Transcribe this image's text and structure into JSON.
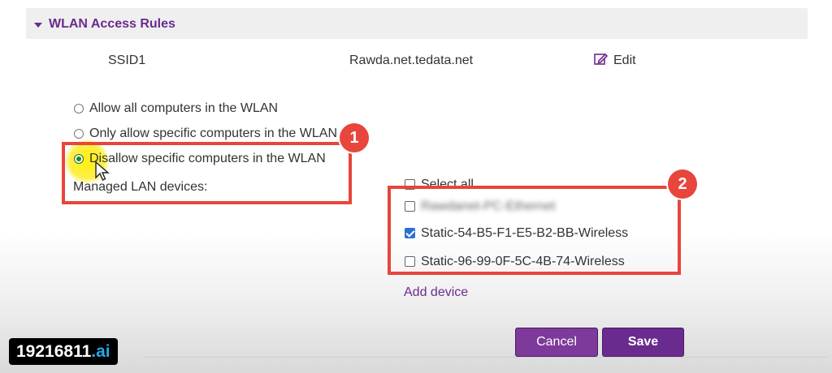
{
  "section": {
    "title": "WLAN Access Rules",
    "ssid_label": "SSID1",
    "ssid_value": "Rawda.net.tedata.net",
    "edit_label": "Edit"
  },
  "options": [
    {
      "label": "Allow all computers in the WLAN",
      "selected": false
    },
    {
      "label": "Only allow specific computers in the WLAN",
      "selected": false
    },
    {
      "label": "Disallow specific computers in the WLAN",
      "selected": true
    }
  ],
  "managed_label": "Managed LAN devices:",
  "devices": {
    "select_all": "Select all",
    "items": [
      {
        "label": "Rawdanet-PC-Ethernet",
        "checked": false
      },
      {
        "label": "Static-54-B5-F1-E5-B2-BB-Wireless",
        "checked": true
      },
      {
        "label": "Static-96-99-0F-5C-4B-74-Wireless",
        "checked": false
      }
    ],
    "add_device": "Add device"
  },
  "annotations": [
    "1",
    "2"
  ],
  "buttons": {
    "cancel": "Cancel",
    "save": "Save"
  },
  "watermark": {
    "main": "19216811",
    "suffix": ".ai"
  },
  "colors": {
    "accent": "#6a2b8f",
    "highlight": "#e8453c",
    "checkbox": "#2b6fd6"
  }
}
